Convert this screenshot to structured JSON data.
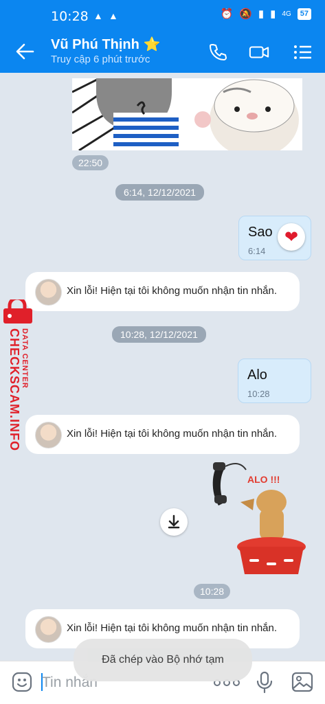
{
  "status_bar": {
    "time": "10:28",
    "network": "4G",
    "battery": "57"
  },
  "header": {
    "contact_name": "Vũ Phú Thịnh",
    "star": "⭐",
    "last_seen": "Truy cập 6 phút trước"
  },
  "messages": {
    "sticker1_time": "22:50",
    "divider1": "6:14, 12/12/2021",
    "msg1_text": "Sao",
    "msg1_time": "6:14",
    "msg1_reaction": "❤",
    "auto_reply_1": "Xin lỗi! Hiện tại tôi không muốn nhận tin nhắn.",
    "divider2": "10:28, 12/12/2021",
    "msg2_text": "Alo",
    "msg2_time": "10:28",
    "auto_reply_2": "Xin lỗi! Hiện tại tôi không muốn nhận tin nhắn.",
    "sticker2_caption": "ALO !!!",
    "sticker2_time": "10:28",
    "auto_reply_3": "Xin lỗi! Hiện tại tôi không muốn nhận tin nhắn."
  },
  "watermark": {
    "line1": "DATA CENTER",
    "line2": "CHECKSCAM.INFO"
  },
  "toast": "Đã chép vào Bộ nhớ tạm",
  "composer": {
    "placeholder": "Tin nhắn"
  },
  "colors": {
    "brand": "#0b86f0",
    "bubble": "#d8ecfb",
    "watermark": "#e0202a"
  }
}
